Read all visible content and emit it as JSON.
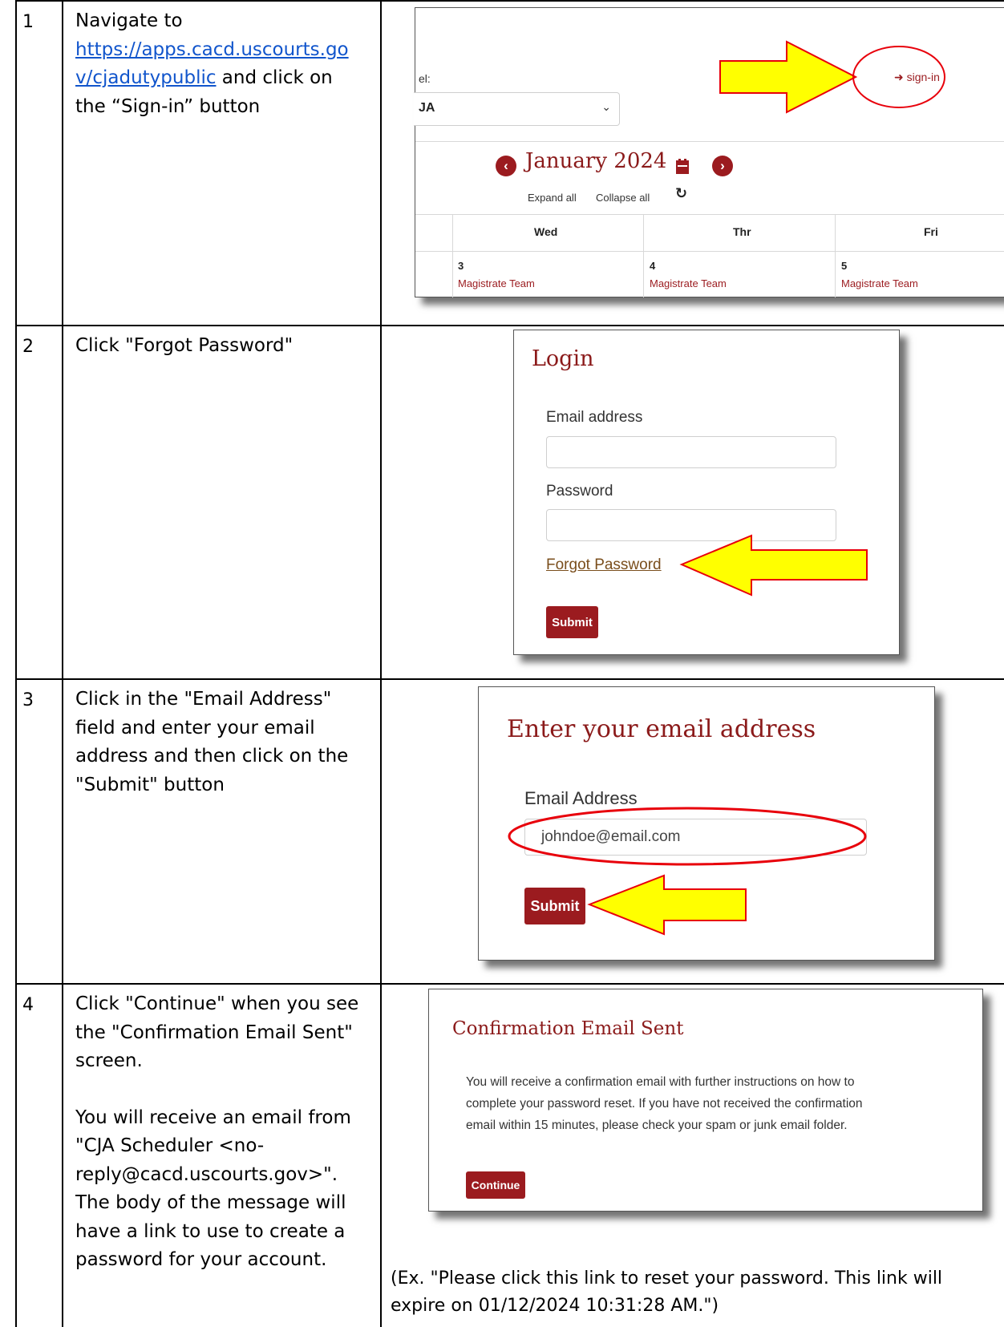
{
  "steps": [
    {
      "number": "1",
      "text_prefix": "Navigate to",
      "link": "https://apps.cacd.uscourts.gov/cjadutypublic",
      "link_line1": "https://apps.cacd.uscourts.go",
      "link_line2": "v/cjadutypublic",
      "text_suffix_1": " and click on",
      "text_suffix_2": "the “Sign-in” button",
      "shot": {
        "select_label": "el:",
        "select_value": "JA",
        "signin": "sign-in",
        "month_title": "January 2024",
        "expand_all": "Expand all",
        "collapse_all": "Collapse all",
        "days": [
          "Wed",
          "Thr",
          "Fri"
        ],
        "dates": [
          "3",
          "4",
          "5"
        ],
        "event_label": "Magistrate Team"
      }
    },
    {
      "number": "2",
      "text": "Click \"Forgot Password\"",
      "shot": {
        "title": "Login",
        "email_label": "Email address",
        "password_label": "Password",
        "forgot_link": "Forgot Password",
        "submit": "Submit"
      }
    },
    {
      "number": "3",
      "lines": [
        "Click in the \"Email Address\"",
        "field and enter your email",
        "address and then click on the",
        "\"Submit\" button"
      ],
      "shot": {
        "title": "Enter your email address",
        "email_label": "Email Address",
        "email_value": "johndoe@email.com",
        "submit": "Submit"
      }
    },
    {
      "number": "4",
      "lines_a": [
        "Click \"Continue\" when you see",
        "the \"Confirmation Email Sent\"",
        "screen."
      ],
      "lines_b": [
        "You will receive an email from",
        "\"CJA Scheduler <no-",
        "reply@cacd.uscourts.gov>\".",
        "The body of the message will",
        "have a link to use to create a",
        "password for your account."
      ],
      "shot": {
        "title": "Confirmation Email Sent",
        "body_lines": [
          "You will receive a confirmation email with further instructions on how to",
          "complete your password reset. If you have not received the confirmation",
          "email within 15 minutes, please check your spam or junk email folder."
        ],
        "continue": "Continue"
      },
      "example_lines": [
        "(Ex. \"Please click this link to reset your password. This link will",
        "expire on 01/12/2024 10:31:28 AM.\")"
      ]
    }
  ],
  "colors": {
    "maroon": "#9b1b1f",
    "arrow_fill": "#ffff00",
    "arrow_stroke": "#e8000b",
    "link": "#1155cc"
  }
}
